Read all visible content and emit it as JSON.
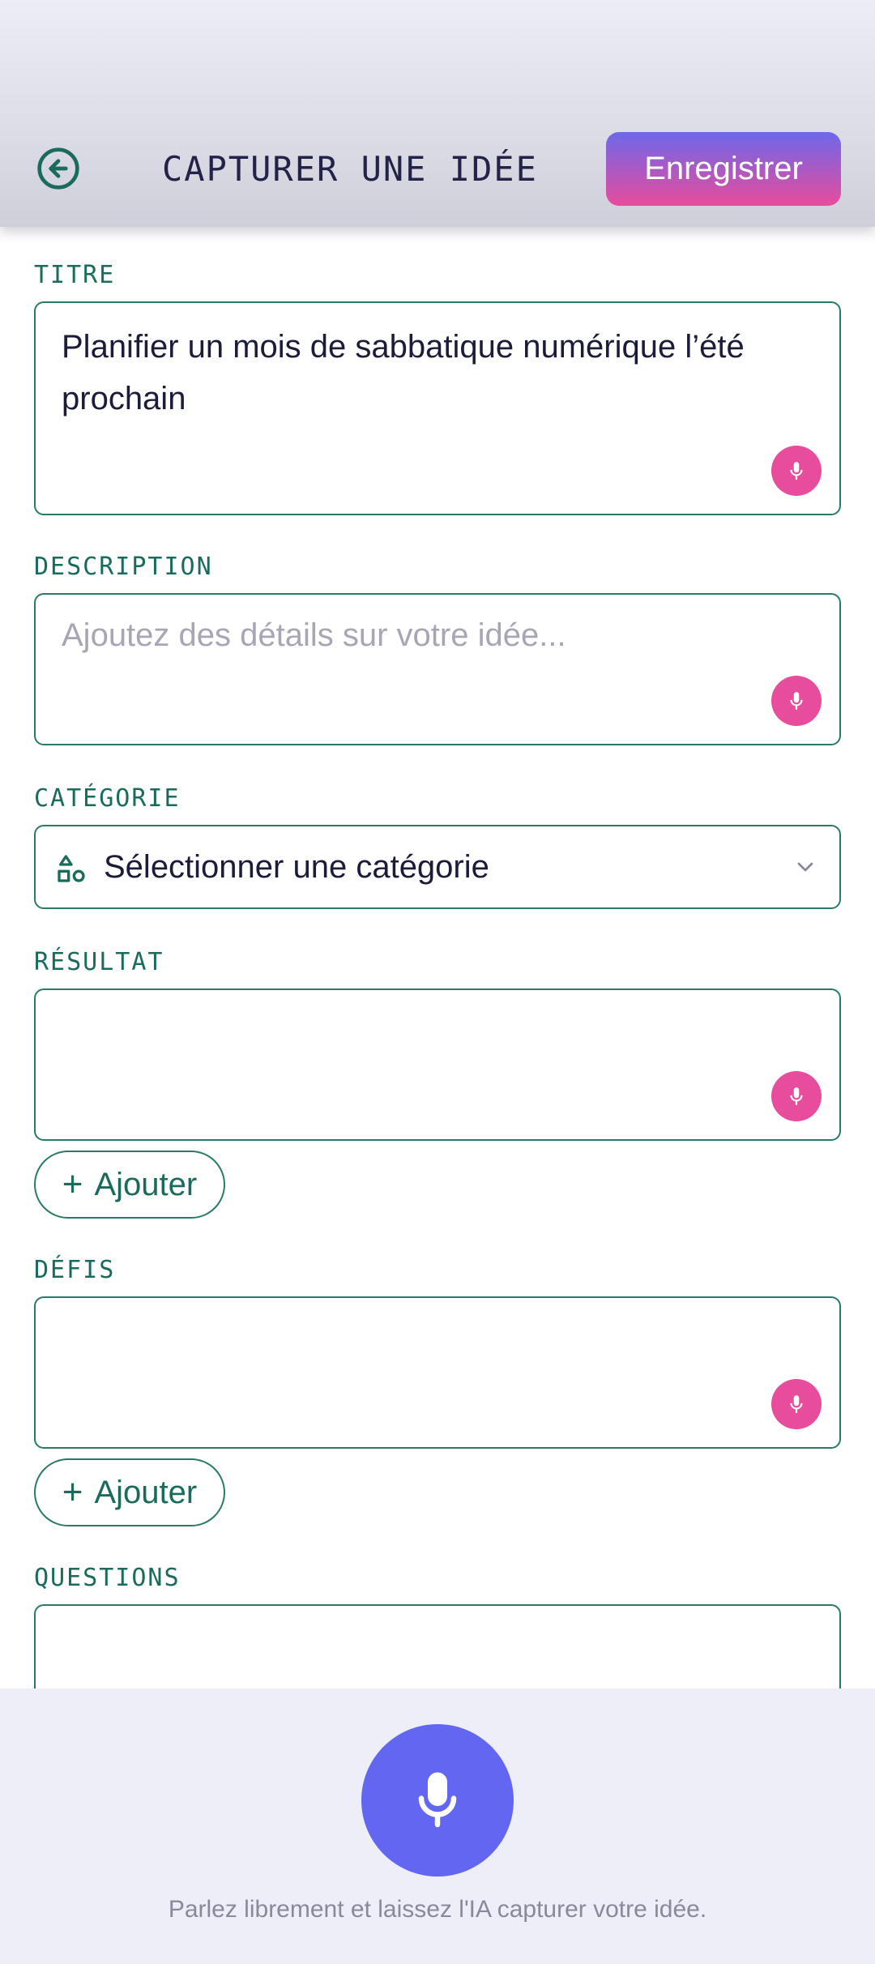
{
  "header": {
    "back_icon": "back-arrow-circle-icon",
    "title": "CAPTURER UNE IDÉE",
    "save_label": "Enregistrer"
  },
  "fields": {
    "title": {
      "label": "TITRE",
      "value": "Planifier un mois de sabbatique numérique l’été prochain",
      "mic_icon": "microphone-icon"
    },
    "description": {
      "label": "DESCRIPTION",
      "placeholder": "Ajoutez des détails sur votre idée...",
      "mic_icon": "microphone-icon"
    },
    "category": {
      "label": "CATÉGORIE",
      "value": "Sélectionner une catégorie",
      "icon": "shapes-icon",
      "chevron_icon": "chevron-down-icon"
    },
    "result": {
      "label": "RÉSULTAT",
      "add_label": "Ajouter",
      "mic_icon": "microphone-icon"
    },
    "challenges": {
      "label": "DÉFIS",
      "add_label": "Ajouter",
      "mic_icon": "microphone-icon"
    },
    "questions": {
      "label": "QUESTIONS"
    }
  },
  "voice": {
    "mic_icon": "microphone-icon",
    "hint": "Parlez librement et laissez l'IA capturer votre idée."
  },
  "colors": {
    "accent": "#1a6b5c",
    "mic_pink": "#e84c9c",
    "mic_indigo": "#6366f1",
    "save_gradient_top": "#6d68ea",
    "save_gradient_bottom": "#e84c9c"
  }
}
